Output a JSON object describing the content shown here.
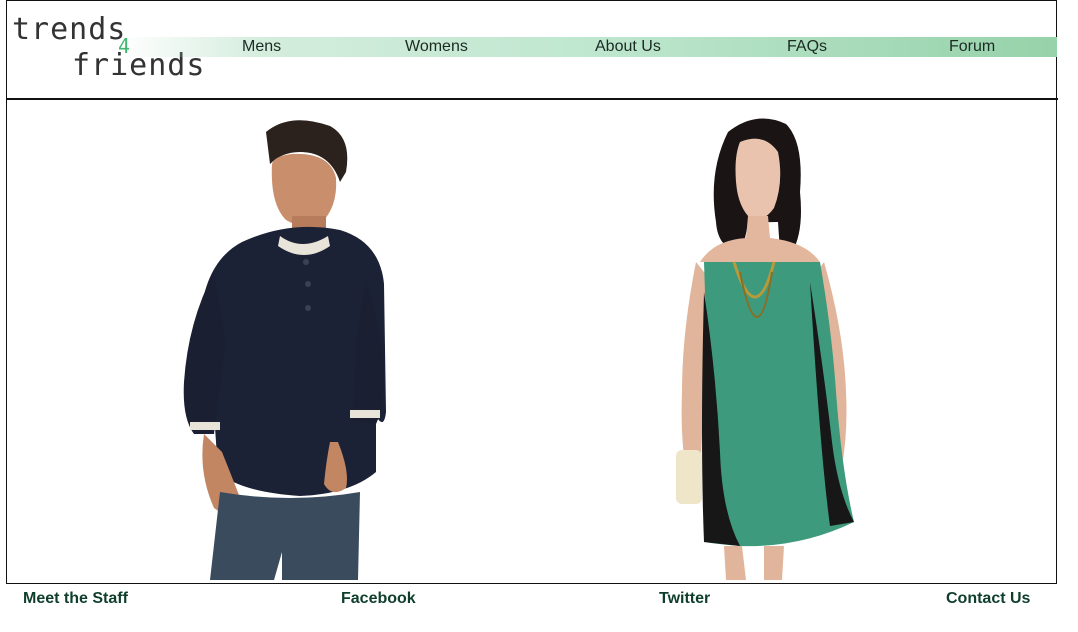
{
  "logo": {
    "line1": "trends",
    "num": "4",
    "line2": "friends"
  },
  "nav": {
    "mens": "Mens",
    "womens": "Womens",
    "about": "About Us",
    "faqs": "FAQs",
    "forum": "Forum"
  },
  "footer": {
    "staff": "Meet the Staff",
    "facebook": "Facebook",
    "twitter": "Twitter",
    "contact": "Contact Us"
  },
  "colors": {
    "accent": "#3fb86e",
    "nav_gradient": "#96d2aa",
    "footer_text": "#0f3f2c"
  }
}
